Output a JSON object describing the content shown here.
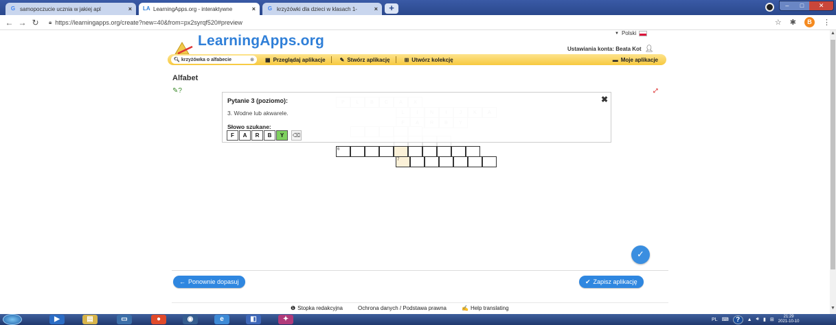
{
  "browser": {
    "tabs": [
      {
        "title": "samopoczucie ucznia w jakiej apl",
        "icon": "G"
      },
      {
        "title": "LearningApps.org - interaktywne",
        "icon": "LA",
        "active": true
      },
      {
        "title": "krzyżówki dla dzieci w klasach 1-",
        "icon": "G"
      }
    ],
    "new_tab": "+",
    "url": "https://learningapps.org/create?new=40&from=px2syrqf520#preview",
    "avatar_letter": "B"
  },
  "header": {
    "language": "Polski",
    "logo": "LearningApps.org",
    "account": "Ustawiania konta: Beata Kot"
  },
  "navbar": {
    "search_value": "krzyżówka o alfabecie",
    "browse": "Przeglądaj aplikacje",
    "create": "Stwórz aplikację",
    "collection": "Utwórz kolekcję",
    "my_apps": "Moje aplikacje"
  },
  "content": {
    "title": "Alfabet"
  },
  "crossword": {
    "faint_rows": [
      [
        "P",
        "L",
        "B",
        "C",
        "A",
        "X"
      ],
      [
        "L",
        "I",
        "N",
        "I",
        "J",
        "K",
        "A"
      ],
      [
        "F",
        "A",
        "R",
        "B",
        "Y"
      ]
    ],
    "row4_number": "6",
    "row5_number": "7"
  },
  "question": {
    "title": "Pytanie 3 (poziomo):",
    "text": "3. Wodne lub akwarele.",
    "word_label": "Słowo szukane:",
    "letters": [
      "F",
      "A",
      "R",
      "B",
      "Y"
    ]
  },
  "actions": {
    "redo": "Ponownie dopasuj",
    "save": "Zapisz aplikację"
  },
  "footer": {
    "links": [
      "Stopka redakcyjna",
      "Ochrona danych / Podstawa prawna",
      "Help translating"
    ]
  },
  "taskbar": {
    "lang": "PL",
    "clock_time": "21:29",
    "clock_date": "2021-10-10"
  },
  "colors": {
    "accent_blue": "#2f87e0",
    "navbar_yellow": "#f7c93f",
    "highlight": "#fbf1d8",
    "letter_green": "#7fd15f"
  }
}
